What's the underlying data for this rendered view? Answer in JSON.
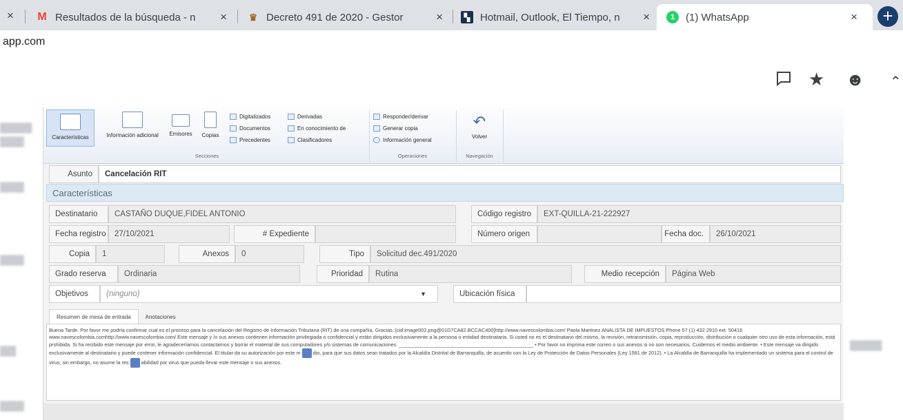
{
  "browser": {
    "tabs": [
      {
        "title": "Resultados de la búsqueda - n"
      },
      {
        "title": "Decreto 491 de 2020 - Gestor"
      },
      {
        "title": "Hotmail, Outlook, El Tiempo, n"
      },
      {
        "title": "(1) WhatsApp",
        "badge": "1"
      }
    ],
    "new_tab_label": "+",
    "url": "app.com",
    "close_glyph": "✕",
    "x_glyph": "×"
  },
  "ribbon": {
    "buttons": [
      {
        "label": "Características"
      },
      {
        "label": "Información adicional"
      },
      {
        "label": "Emisores"
      },
      {
        "label": "Copias"
      }
    ],
    "col1": [
      "Digitalizados",
      "Documentos",
      "Precedentes"
    ],
    "col2": [
      "Derivadas",
      "En conocimiento de",
      "Clasificadores"
    ],
    "col3": [
      "Responder/derivar",
      "Generar copia",
      "Información general"
    ],
    "back_label": "Volver",
    "groups": {
      "secciones": "Secciones",
      "operaciones": "Operaciones",
      "navegacion": "Navegación"
    }
  },
  "asunto": {
    "label": "Asunto",
    "value": "Cancelación RIT"
  },
  "section_title": "Características",
  "fields": {
    "destinatario": {
      "label": "Destinatario",
      "value": "CASTAÑO DUQUE,FIDEL ANTONIO"
    },
    "codigo_registro": {
      "label": "Código registro",
      "value": "EXT-QUILLA-21-222927"
    },
    "fecha_registro": {
      "label": "Fecha registro",
      "value": "27/10/2021"
    },
    "expediente": {
      "label": "# Expediente",
      "value": ""
    },
    "numero_origen": {
      "label": "Número origen",
      "value": ""
    },
    "fecha_doc": {
      "label": "Fecha doc.",
      "value": "26/10/2021"
    },
    "copia": {
      "label": "Copia",
      "value": "1"
    },
    "anexos": {
      "label": "Anexos",
      "value": "0"
    },
    "tipo": {
      "label": "Tipo",
      "value": "Solicitud dec.491/2020"
    },
    "grado_reserva": {
      "label": "Grado reserva",
      "value": "Ordinaria"
    },
    "prioridad": {
      "label": "Prioridad",
      "value": "Rutina"
    },
    "medio_recepcion": {
      "label": "Medio recepción",
      "value": "Página Web"
    },
    "objetivos": {
      "label": "Objetivos",
      "value": "(ninguno)"
    },
    "ubicacion_fisica": {
      "label": "Ubicación física",
      "value": ""
    }
  },
  "content_tabs": [
    "Resumen de mesa de entrada",
    "Anotaciones"
  ],
  "summary_text_1": "Buena Tarde. Por favor me podría confirmar cual es el proceso para la cancelación del Registro de Información Tributaria (RIT) de una compañía. Gracias. [cid:image002.png@01D7CA82.BCCAC400]http://www.navescolombia.com/ Paola Martinez ANALISTA DE IMPUESTOS Phone 57 (1) 432 2910 ext. 50416 www.navescolombia.comhttp://www.navescolombia.com/ Este mensaje y /o sus anexos contienen información privilegiada o confidencial y están dirigidos exclusivamente a la persona o entidad destinataria. Si usted no es el destinatario del mismo, la revisión, retransmisión, copia, reproducción, distribución o cualquier otro uso de esta información, está prohibida. Si ha recibido este mensaje por error, le agradeceríamos contactarnos y borrar el material de sus computadores y/o sistemas de comunicaciones. ________________________________________________ • Por favor no imprima este correo o sus anexos si no son necesarios. Cuidemos el medio ambiente. • Este mensaje va dirigido exclusivamente al destinatario y puede contener información confidencial. El titular da su autorización por este m",
  "summary_text_2": "dio, para que sus datos sean tratados por la Alcaldía Distrital de Barranquilla, de acuerdo con la Ley de Protección de Datos Personales (Ley 1581 de 2012). • La Alcaldía de Barranquilla ha implementado un sistema para el control de virus; sin embargo, no asume la res",
  "summary_text_3": "abilidad por virus que pueda llevar este mensaje o sus anexos.",
  "colors": {
    "accent": "#dbe9f3",
    "whatsapp": "#25d366",
    "gmail": "#ea4335"
  }
}
